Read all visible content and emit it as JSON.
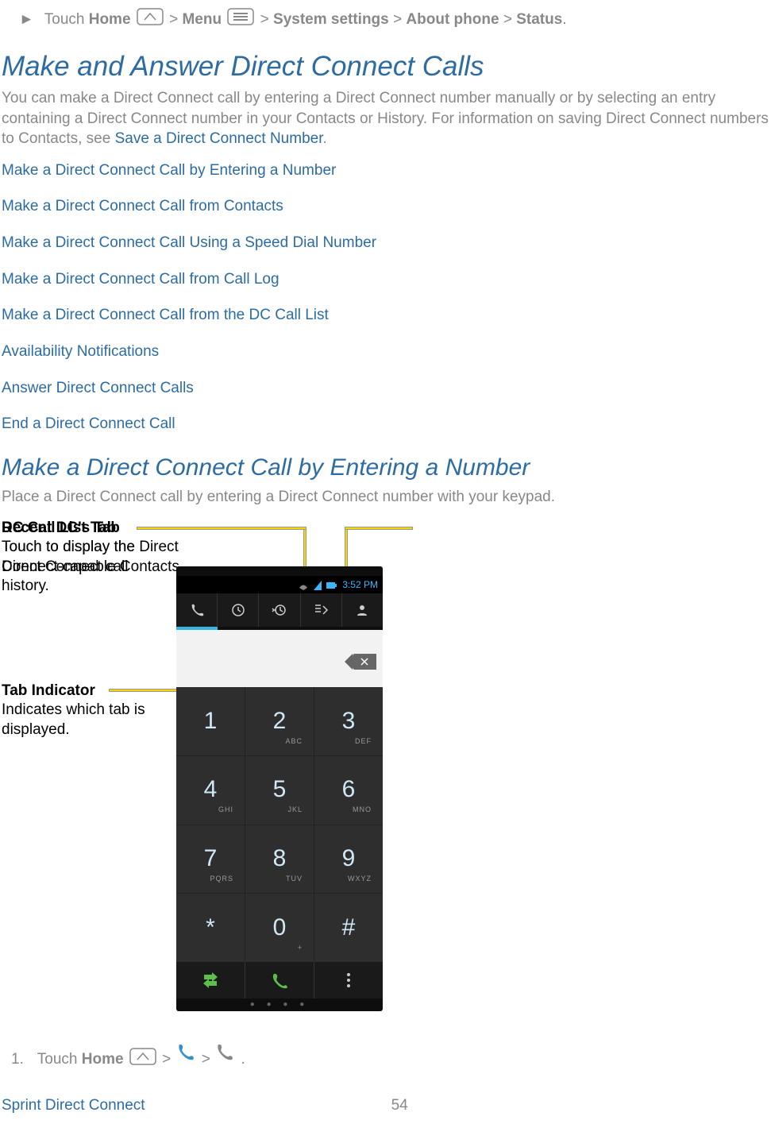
{
  "intro_bullet": {
    "prefix": "Touch ",
    "home": "Home",
    "gt1": " > ",
    "menu": "Menu",
    "rest": " > ",
    "ss": "System settings",
    "gt2": " > ",
    "ap": "About phone",
    "gt3": " > ",
    "status": "Status",
    "period": "."
  },
  "h1": "Make and Answer Direct Connect Calls",
  "p1a": "You can make a Direct Connect call by entering a Direct Connect number manually or by selecting an entry containing a Direct Connect number in your Contacts or History. For information on saving Direct Connect numbers to Contacts, see ",
  "p1link": "Save a Direct Connect Number",
  "p1b": ".",
  "links": [
    "Make a Direct Connect Call by Entering a Number",
    "Make a Direct Connect Call from Contacts",
    "Make a Direct Connect Call Using a Speed Dial Number",
    "Make a Direct Connect Call from Call Log",
    "Make a Direct Connect Call from the DC Call List",
    "Availability Notifications",
    "Answer Direct Connect Calls",
    "End a Direct Connect Call"
  ],
  "h2": "Make a Direct Connect Call by Entering a Number",
  "p2": "Place a Direct Connect call by entering a Direct Connect number with your keypad.",
  "callouts": {
    "recent": {
      "title": "Recent DC's Tab",
      "desc": "Touch to display the Direct Connect call history."
    },
    "dclist": {
      "title": "DC Call List Tab",
      "desc": "Touch to display the Direct Connect-capable Contacts."
    },
    "tabind": {
      "title": "Tab Indicator",
      "desc": "Indicates which tab is displayed."
    }
  },
  "phone": {
    "time": "3:52 PM",
    "keys": [
      {
        "n": "1",
        "s": ""
      },
      {
        "n": "2",
        "s": "ABC"
      },
      {
        "n": "3",
        "s": "DEF"
      },
      {
        "n": "4",
        "s": "GHI"
      },
      {
        "n": "5",
        "s": "JKL"
      },
      {
        "n": "6",
        "s": "MNO"
      },
      {
        "n": "7",
        "s": "PQRS"
      },
      {
        "n": "8",
        "s": "TUV"
      },
      {
        "n": "9",
        "s": "WXYZ"
      },
      {
        "n": "*",
        "s": ""
      },
      {
        "n": "0",
        "s": "+"
      },
      {
        "n": "#",
        "s": ""
      }
    ]
  },
  "step1": {
    "num": "1.",
    "prefix": "Touch ",
    "home": "Home",
    "seq": " > ",
    "seq2": " > ",
    "period": "."
  },
  "footer": {
    "title": "Sprint Direct Connect",
    "page": "54"
  }
}
